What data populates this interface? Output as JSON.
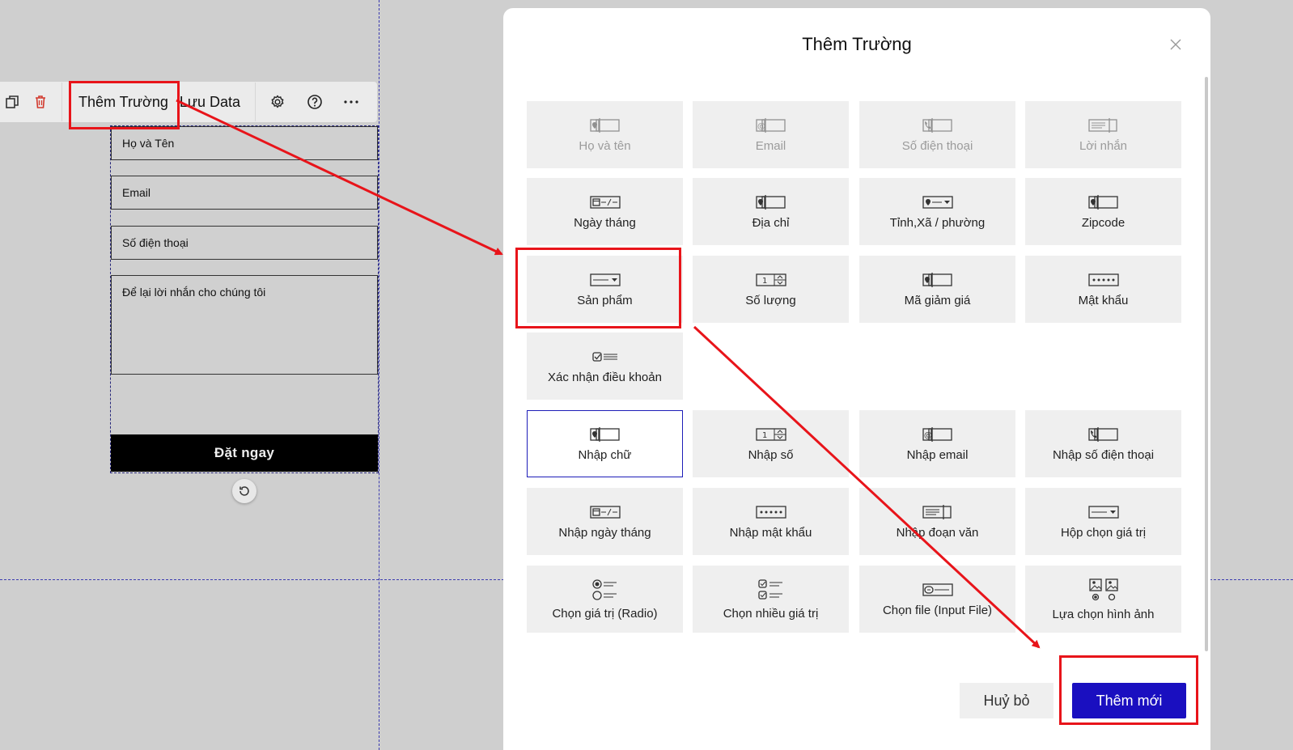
{
  "toolbar": {
    "add_field_label": "Thêm Trường",
    "save_data_label": "Lưu Data",
    "icons": [
      "copy-icon",
      "trash-icon",
      "gear-icon",
      "help-icon",
      "more-icon"
    ]
  },
  "form": {
    "fields": [
      {
        "label": "Họ và Tên"
      },
      {
        "label": "Email"
      },
      {
        "label": "Số điện thoại"
      },
      {
        "label": "Để lại lời nhắn cho chúng tôi"
      }
    ],
    "submit_label": "Đặt ngay"
  },
  "modal": {
    "title": "Thêm Trường",
    "cancel_label": "Huỷ bỏ",
    "add_label": "Thêm mới",
    "accent_color": "#1a0fc0"
  },
  "tiles": [
    {
      "label": "Họ và tên",
      "icon": "text-field-icon",
      "state": "disabled"
    },
    {
      "label": "Email",
      "icon": "email-field-icon",
      "state": "disabled"
    },
    {
      "label": "Số điện thoại",
      "icon": "phone-field-icon",
      "state": "disabled"
    },
    {
      "label": "Lời nhắn",
      "icon": "textarea-field-icon",
      "state": "disabled"
    },
    {
      "label": "Ngày tháng",
      "icon": "date-field-icon",
      "state": "normal"
    },
    {
      "label": "Địa chỉ",
      "icon": "text-field-icon",
      "state": "normal"
    },
    {
      "label": "Tỉnh,Xã / phường",
      "icon": "location-select-icon",
      "state": "normal"
    },
    {
      "label": "Zipcode",
      "icon": "text-field-icon",
      "state": "normal"
    },
    {
      "label": "Sản phẩm",
      "icon": "dropdown-icon",
      "state": "normal"
    },
    {
      "label": "Số lượng",
      "icon": "number-field-icon",
      "state": "normal"
    },
    {
      "label": "Mã giảm giá",
      "icon": "text-field-icon",
      "state": "normal"
    },
    {
      "label": "Mật khẩu",
      "icon": "password-field-icon",
      "state": "normal"
    },
    {
      "label": "Xác nhận điều khoản",
      "icon": "checkbox-list-icon",
      "state": "normal"
    },
    {
      "label": "Nhập chữ",
      "icon": "text-field-icon",
      "state": "selected"
    },
    {
      "label": "Nhập số",
      "icon": "number-field-icon",
      "state": "normal"
    },
    {
      "label": "Nhập email",
      "icon": "email-field-icon",
      "state": "normal"
    },
    {
      "label": "Nhập số điện thoại",
      "icon": "phone-field-icon",
      "state": "normal"
    },
    {
      "label": "Nhập ngày tháng",
      "icon": "date-field-icon",
      "state": "normal"
    },
    {
      "label": "Nhập mật khẩu",
      "icon": "password-field-icon",
      "state": "normal"
    },
    {
      "label": "Nhập đoạn văn",
      "icon": "textarea-field-icon",
      "state": "normal"
    },
    {
      "label": "Hộp chọn giá trị",
      "icon": "dropdown-icon",
      "state": "normal"
    },
    {
      "label": "Chọn giá trị (Radio)",
      "icon": "radio-icon",
      "state": "normal"
    },
    {
      "label": "Chọn nhiều giá trị",
      "icon": "multi-checkbox-icon",
      "state": "normal"
    },
    {
      "label": "Chọn file (Input File)",
      "icon": "file-input-icon",
      "state": "normal"
    },
    {
      "label": "Lựa chọn hình ảnh",
      "icon": "image-choice-icon",
      "state": "normal"
    }
  ],
  "annotation_color": "#e8141a"
}
